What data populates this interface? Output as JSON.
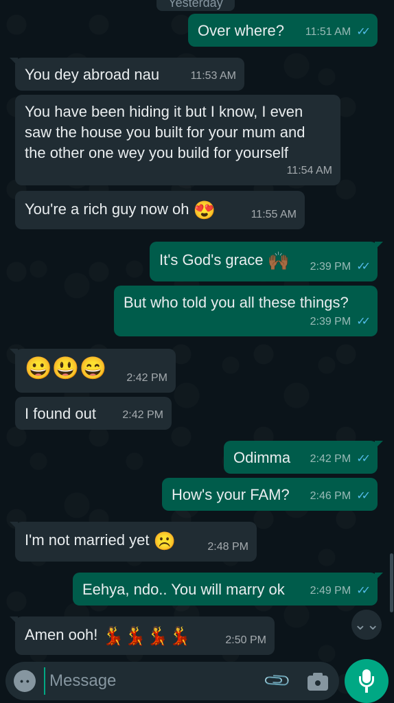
{
  "chat": {
    "date_chip": "Yesterday",
    "messages": [
      {
        "dir": "out",
        "text": "Over where?",
        "time": "11:51 AM"
      },
      {
        "dir": "in",
        "text": "You dey abroad nau",
        "time": "11:53 AM"
      },
      {
        "dir": "in",
        "text": "You have been hiding it but I know, I even saw the house you built for your mum and the other one wey you build for yourself",
        "time": "11:54 AM"
      },
      {
        "dir": "in",
        "text": "You're a rich guy now oh",
        "emoji": "😍",
        "time": "11:55 AM"
      },
      {
        "dir": "out",
        "text": "It's God's grace",
        "emoji": "🙌🏾",
        "time": "2:39 PM"
      },
      {
        "dir": "out",
        "text": "But who told you all these things?",
        "time": "2:39 PM"
      },
      {
        "dir": "in",
        "text": "😀😃😄",
        "time": "2:42 PM"
      },
      {
        "dir": "in",
        "text": "I found out",
        "time": "2:42 PM"
      },
      {
        "dir": "out",
        "text": "Odimma",
        "time": "2:42 PM"
      },
      {
        "dir": "out",
        "text": "How's your FAM?",
        "time": "2:46 PM"
      },
      {
        "dir": "in",
        "text": "I'm not married yet",
        "emoji": "☹️",
        "time": "2:48 PM"
      },
      {
        "dir": "out",
        "text": "Eehya, ndo.. You will marry ok",
        "time": "2:49 PM"
      },
      {
        "dir": "in",
        "text": "Amen ooh!",
        "emoji": "💃💃💃💃",
        "time": "2:50 PM"
      }
    ],
    "read_ticks": "✓✓",
    "scroll_down_icon": "double-chevron-down-icon"
  },
  "composer": {
    "placeholder": "Message",
    "emoji_icon": "emoji-icon",
    "attach_icon": "paperclip-icon",
    "camera_icon": "camera-icon",
    "mic_icon": "mic-icon",
    "attach_glyph": "📎",
    "scroll_glyph": "⌄⌄"
  },
  "colors": {
    "background": "#0b141a",
    "incoming_bubble": "#202c33",
    "outgoing_bubble": "#005c4b",
    "read_ticks": "#53bdeb",
    "accent": "#00a884"
  }
}
